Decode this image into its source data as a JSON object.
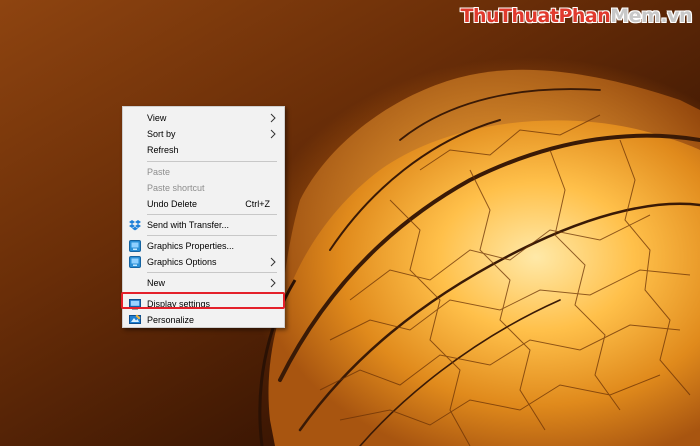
{
  "watermark": {
    "part1": "Thu",
    "part2": "Thuat",
    "part3": "Phan",
    "part4": "Mem",
    "part5": ".vn"
  },
  "context_menu": {
    "items": [
      {
        "label": "View",
        "has_submenu": true
      },
      {
        "label": "Sort by",
        "has_submenu": true
      },
      {
        "label": "Refresh"
      },
      {
        "label": "Paste",
        "disabled": true
      },
      {
        "label": "Paste shortcut",
        "disabled": true
      },
      {
        "label": "Undo Delete",
        "shortcut": "Ctrl+Z"
      },
      {
        "label": "Send with Transfer...",
        "icon": "dropbox-icon"
      },
      {
        "label": "Graphics Properties...",
        "icon": "intel-graphics-icon"
      },
      {
        "label": "Graphics Options",
        "icon": "intel-graphics-icon",
        "has_submenu": true
      },
      {
        "label": "New",
        "has_submenu": true
      },
      {
        "label": "Display settings",
        "icon": "display-icon",
        "highlighted": true
      },
      {
        "label": "Personalize",
        "icon": "personalize-icon"
      }
    ]
  },
  "colors": {
    "highlight_border": "#e4202a",
    "menu_background": "#f2f2f2"
  }
}
